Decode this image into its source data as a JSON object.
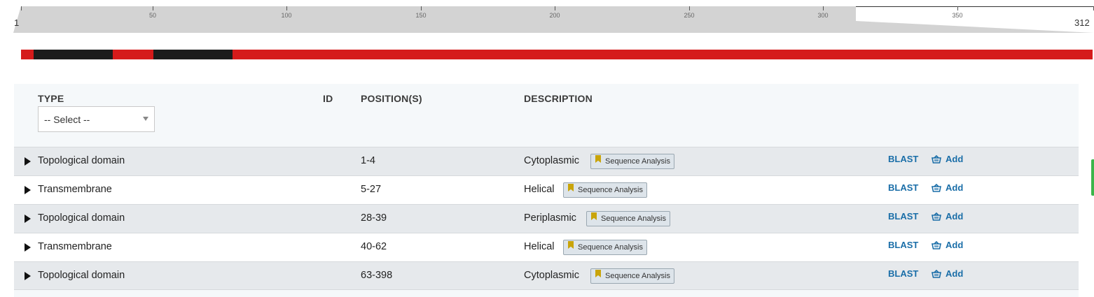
{
  "ruler": {
    "start_label": "1",
    "end_label": "312",
    "ticks": [
      "50",
      "100",
      "150",
      "200",
      "250",
      "300",
      "350"
    ]
  },
  "track": {
    "color_background": "#d51b1b",
    "color_segment": "#1c1c1c"
  },
  "table": {
    "headers": {
      "type": "TYPE",
      "id": "ID",
      "positions": "POSITION(S)",
      "description": "DESCRIPTION"
    },
    "type_filter": {
      "selected": "-- Select --"
    },
    "rows": [
      {
        "type": "Topological domain",
        "position": "1-4",
        "description": "Cytoplasmic",
        "evidence": "Sequence Analysis",
        "blast": "BLAST",
        "add": "Add"
      },
      {
        "type": "Transmembrane",
        "position": "5-27",
        "description": "Helical",
        "evidence": "Sequence Analysis",
        "blast": "BLAST",
        "add": "Add"
      },
      {
        "type": "Topological domain",
        "position": "28-39",
        "description": "Periplasmic",
        "evidence": "Sequence Analysis",
        "blast": "BLAST",
        "add": "Add"
      },
      {
        "type": "Transmembrane",
        "position": "40-62",
        "description": "Helical",
        "evidence": "Sequence Analysis",
        "blast": "BLAST",
        "add": "Add"
      },
      {
        "type": "Topological domain",
        "position": "63-398",
        "description": "Cytoplasmic",
        "evidence": "Sequence Analysis",
        "blast": "BLAST",
        "add": "Add"
      }
    ]
  },
  "colors": {
    "link": "#1a6ea8",
    "evidence_bookmark": "#c9a40a",
    "row_shade": "#e6e9ec"
  }
}
